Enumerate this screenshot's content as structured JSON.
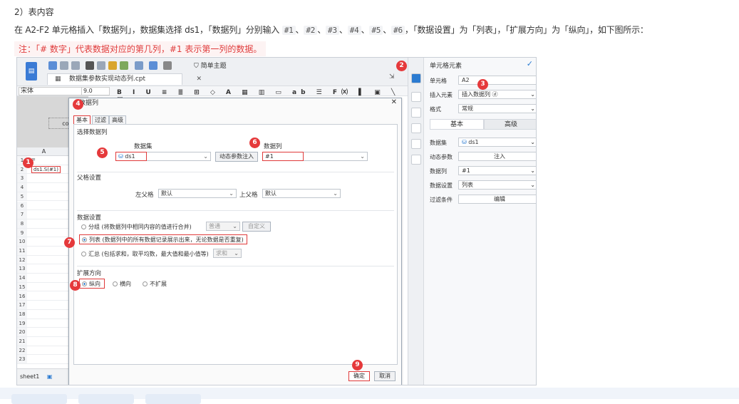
{
  "doc": {
    "heading": "2）表内容",
    "para_prefix": "在 A2-F2 单元格插入「数据列」，数据集选择 ds1，「数据列」分别输入 ",
    "codes": [
      "#1",
      "#2",
      "#3",
      "#4",
      "#5",
      "#6"
    ],
    "para_suffix": "，「数据设置」为「列表」，「扩展方向」为「纵向」，如下图所示：",
    "note": "注：「# 数字」代表数据对应的第几列，#1 表示第一列的数据。"
  },
  "designer": {
    "tab_label": "数据集参数实现动态列.cpt",
    "theme_label": "简单主题",
    "font": "宋体",
    "font_size": "9.0",
    "cell_marker": "col",
    "sheet_label": "sheet1",
    "col_header": "A",
    "grid_rows": [
      "1",
      "2",
      "3",
      "4",
      "5",
      "6",
      "7",
      "8",
      "9",
      "10",
      "11",
      "12",
      "13",
      "14",
      "15",
      "16",
      "17",
      "18",
      "19",
      "20",
      "21",
      "22",
      "23"
    ],
    "row1_value": "=",
    "row2_value": "ds1.S(#1)"
  },
  "dialog": {
    "title": "数据列",
    "tabs": [
      "基本",
      "过滤",
      "高级"
    ],
    "sec_select": "选择数据列",
    "lbl_dataset": "数据集",
    "lbl_column": "数据列",
    "dataset_value": "ds1",
    "dynamic_btn": "动态参数注入",
    "column_value": "#1",
    "sec_parent": "父格设置",
    "lbl_left_parent": "左父格",
    "left_parent_value": "默认",
    "lbl_up_parent": "上父格",
    "up_parent_value": "默认",
    "sec_data": "数据设置",
    "opt_group": "分组 (将数据列中相同内容的值进行合并)",
    "group_mode": "普通",
    "custom_btn": "自定义",
    "opt_list": "列表 (数据列中的所有数据记录展示出来，无论数据是否重复)",
    "opt_summary": "汇总 (包括求和，取平均数，最大值和最小值等)",
    "summary_mode": "求和",
    "sec_expand": "扩展方向",
    "opt_vertical": "纵向",
    "opt_horizontal": "横向",
    "opt_none": "不扩展",
    "ok": "确定",
    "cancel": "取消"
  },
  "panel": {
    "title": "单元格元素",
    "lbl_cell": "单元格",
    "cell_value": "A2",
    "lbl_insert": "插入元素",
    "insert_value": "插入数据列 ⓓ",
    "lbl_style": "格式",
    "style_value": "常规",
    "tab_basic": "基本",
    "tab_advanced": "高级",
    "lbl_dataset": "数据集",
    "dataset_value": "ds1",
    "lbl_dynamic": "动态参数",
    "dynamic_btn": "注入",
    "lbl_column": "数据列",
    "column_value": "#1",
    "lbl_datasetting": "数据设置",
    "datasetting_value": "列表",
    "lbl_filter": "过滤条件",
    "filter_btn": "编辑"
  },
  "badges": [
    "1",
    "2",
    "3",
    "4",
    "5",
    "6",
    "7",
    "8",
    "9"
  ],
  "colors": {
    "accent": "#e5393b",
    "primary": "#2b7bd1"
  }
}
